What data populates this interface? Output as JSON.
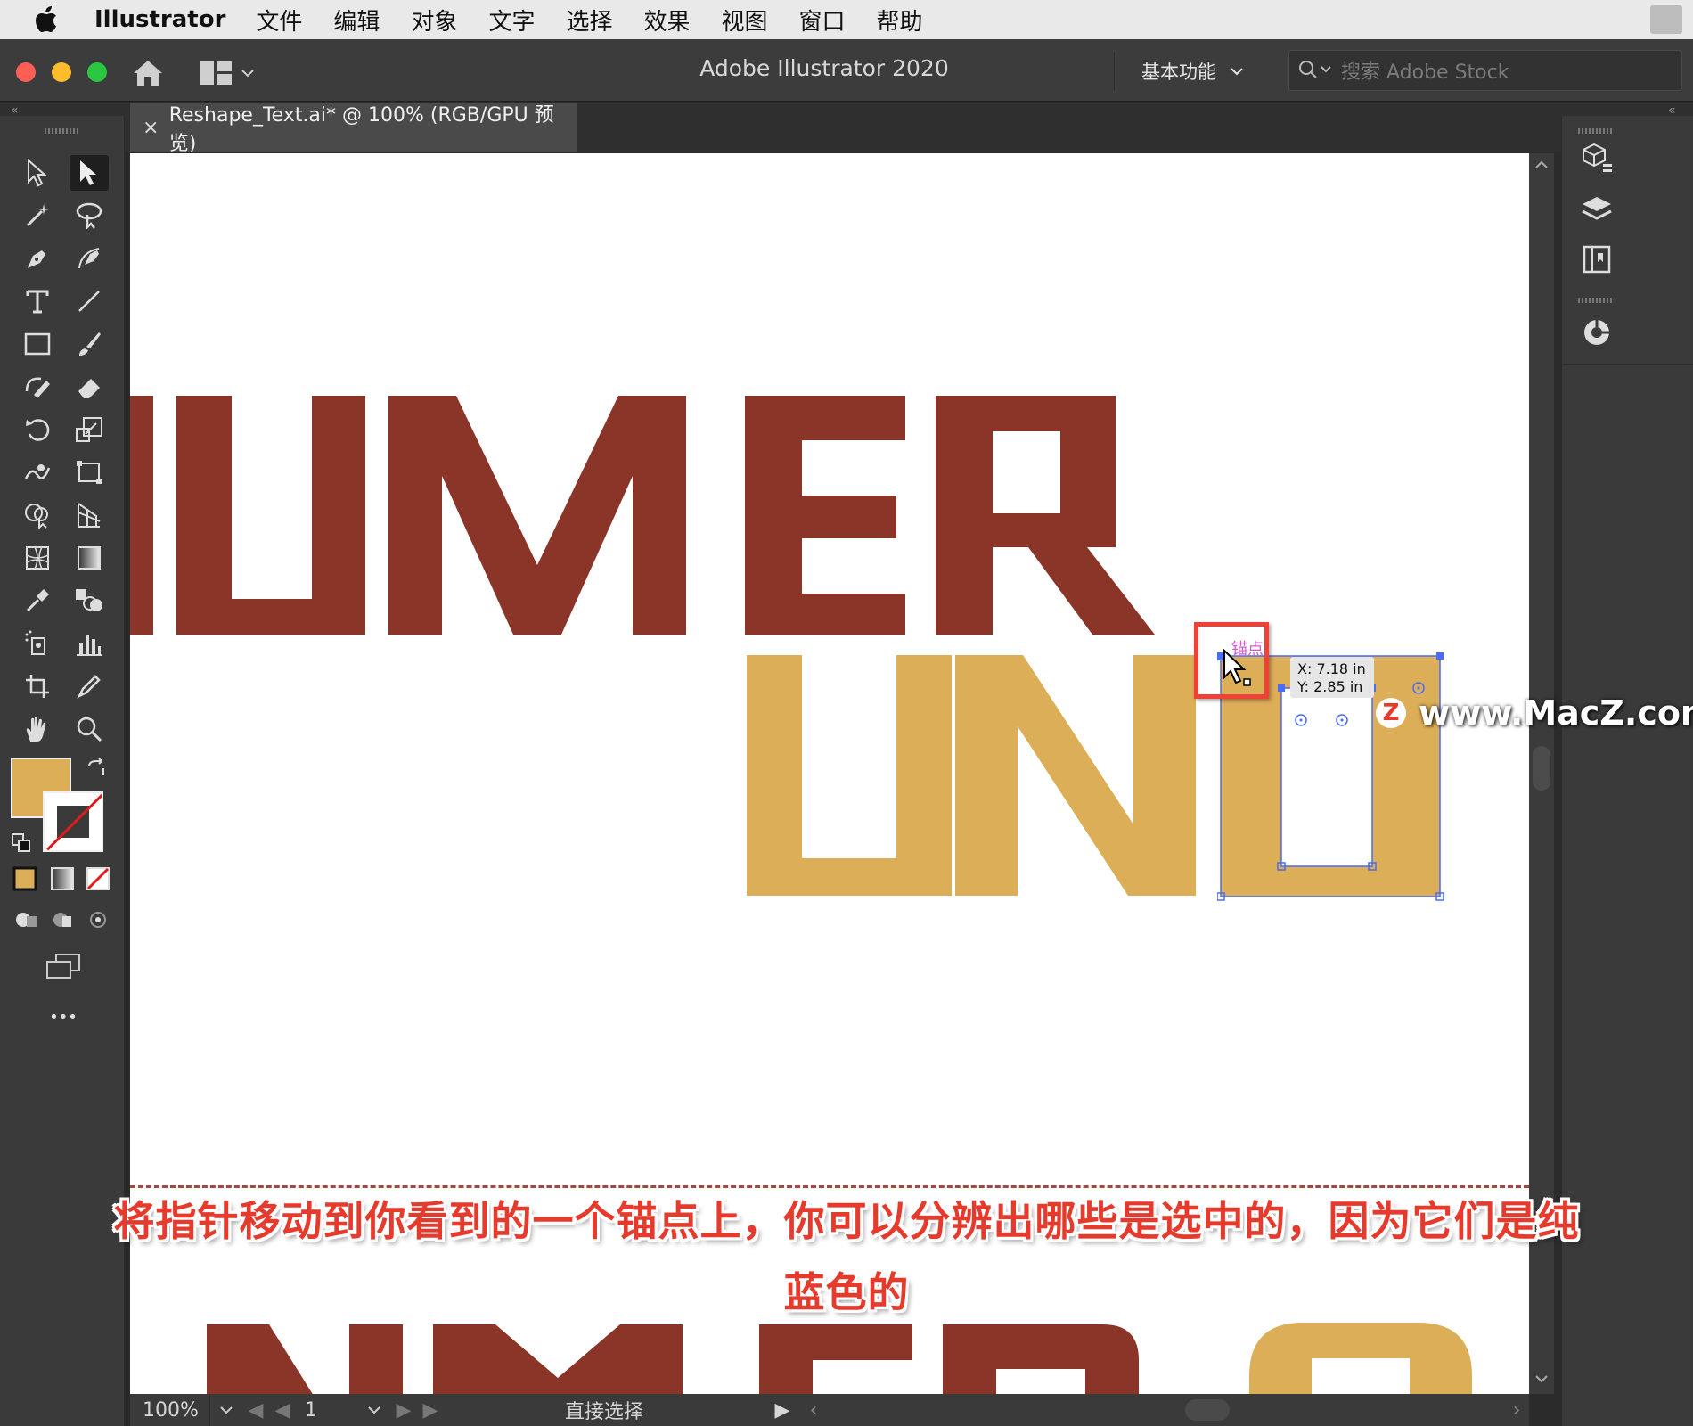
{
  "menubar": {
    "app_name": "Illustrator",
    "items": [
      "文件",
      "编辑",
      "对象",
      "文字",
      "选择",
      "效果",
      "视图",
      "窗口",
      "帮助"
    ]
  },
  "titlebar": {
    "title": "Adobe Illustrator 2020",
    "workspace": "基本功能",
    "search_placeholder": "搜索 Adobe Stock"
  },
  "document_tab": {
    "close_glyph": "×",
    "label": "Reshape_Text.ai* @ 100% (RGB/GPU 预览)"
  },
  "canvas": {
    "line1_text": "IUMER",
    "line2_text": "UNO",
    "line3_text": "NMERO",
    "anchor_hint": "锚点",
    "tooltip_x": "X: 7.18 in",
    "tooltip_y": "Y: 2.85 in",
    "colors": {
      "red_glyphs": "#8b3529",
      "gold_glyphs": "#dcae57",
      "selection": "#4a6cf7",
      "highlight_box": "#ef4136"
    }
  },
  "statusbar": {
    "zoom": "100%",
    "artboard": "1",
    "tool": "直接选择"
  },
  "subtitle": {
    "line1": "将指针移动到你看到的一个锚点上，你可以分辨出哪些是选中的，因为它们是纯",
    "line2": "蓝色的"
  },
  "watermark": {
    "badge": "Z",
    "text": "www.MacZ.com"
  },
  "toolbar": {
    "icons": [
      "selection-tool-icon",
      "direct-selection-tool-icon",
      "magic-wand-icon",
      "lasso-icon",
      "pen-icon",
      "curvature-icon",
      "type-icon",
      "line-icon",
      "rectangle-icon",
      "paintbrush-icon",
      "shaper-icon",
      "eraser-icon",
      "rotate-icon",
      "scale-icon",
      "warp-icon",
      "free-transform-icon",
      "shape-builder-icon",
      "perspective-icon",
      "mesh-icon",
      "gradient-icon",
      "eyedropper-icon",
      "blend-icon",
      "symbol-sprayer-icon",
      "column-graph-icon",
      "artboard-icon",
      "slice-icon",
      "hand-icon",
      "zoom-icon"
    ],
    "more_glyph": "•••"
  }
}
